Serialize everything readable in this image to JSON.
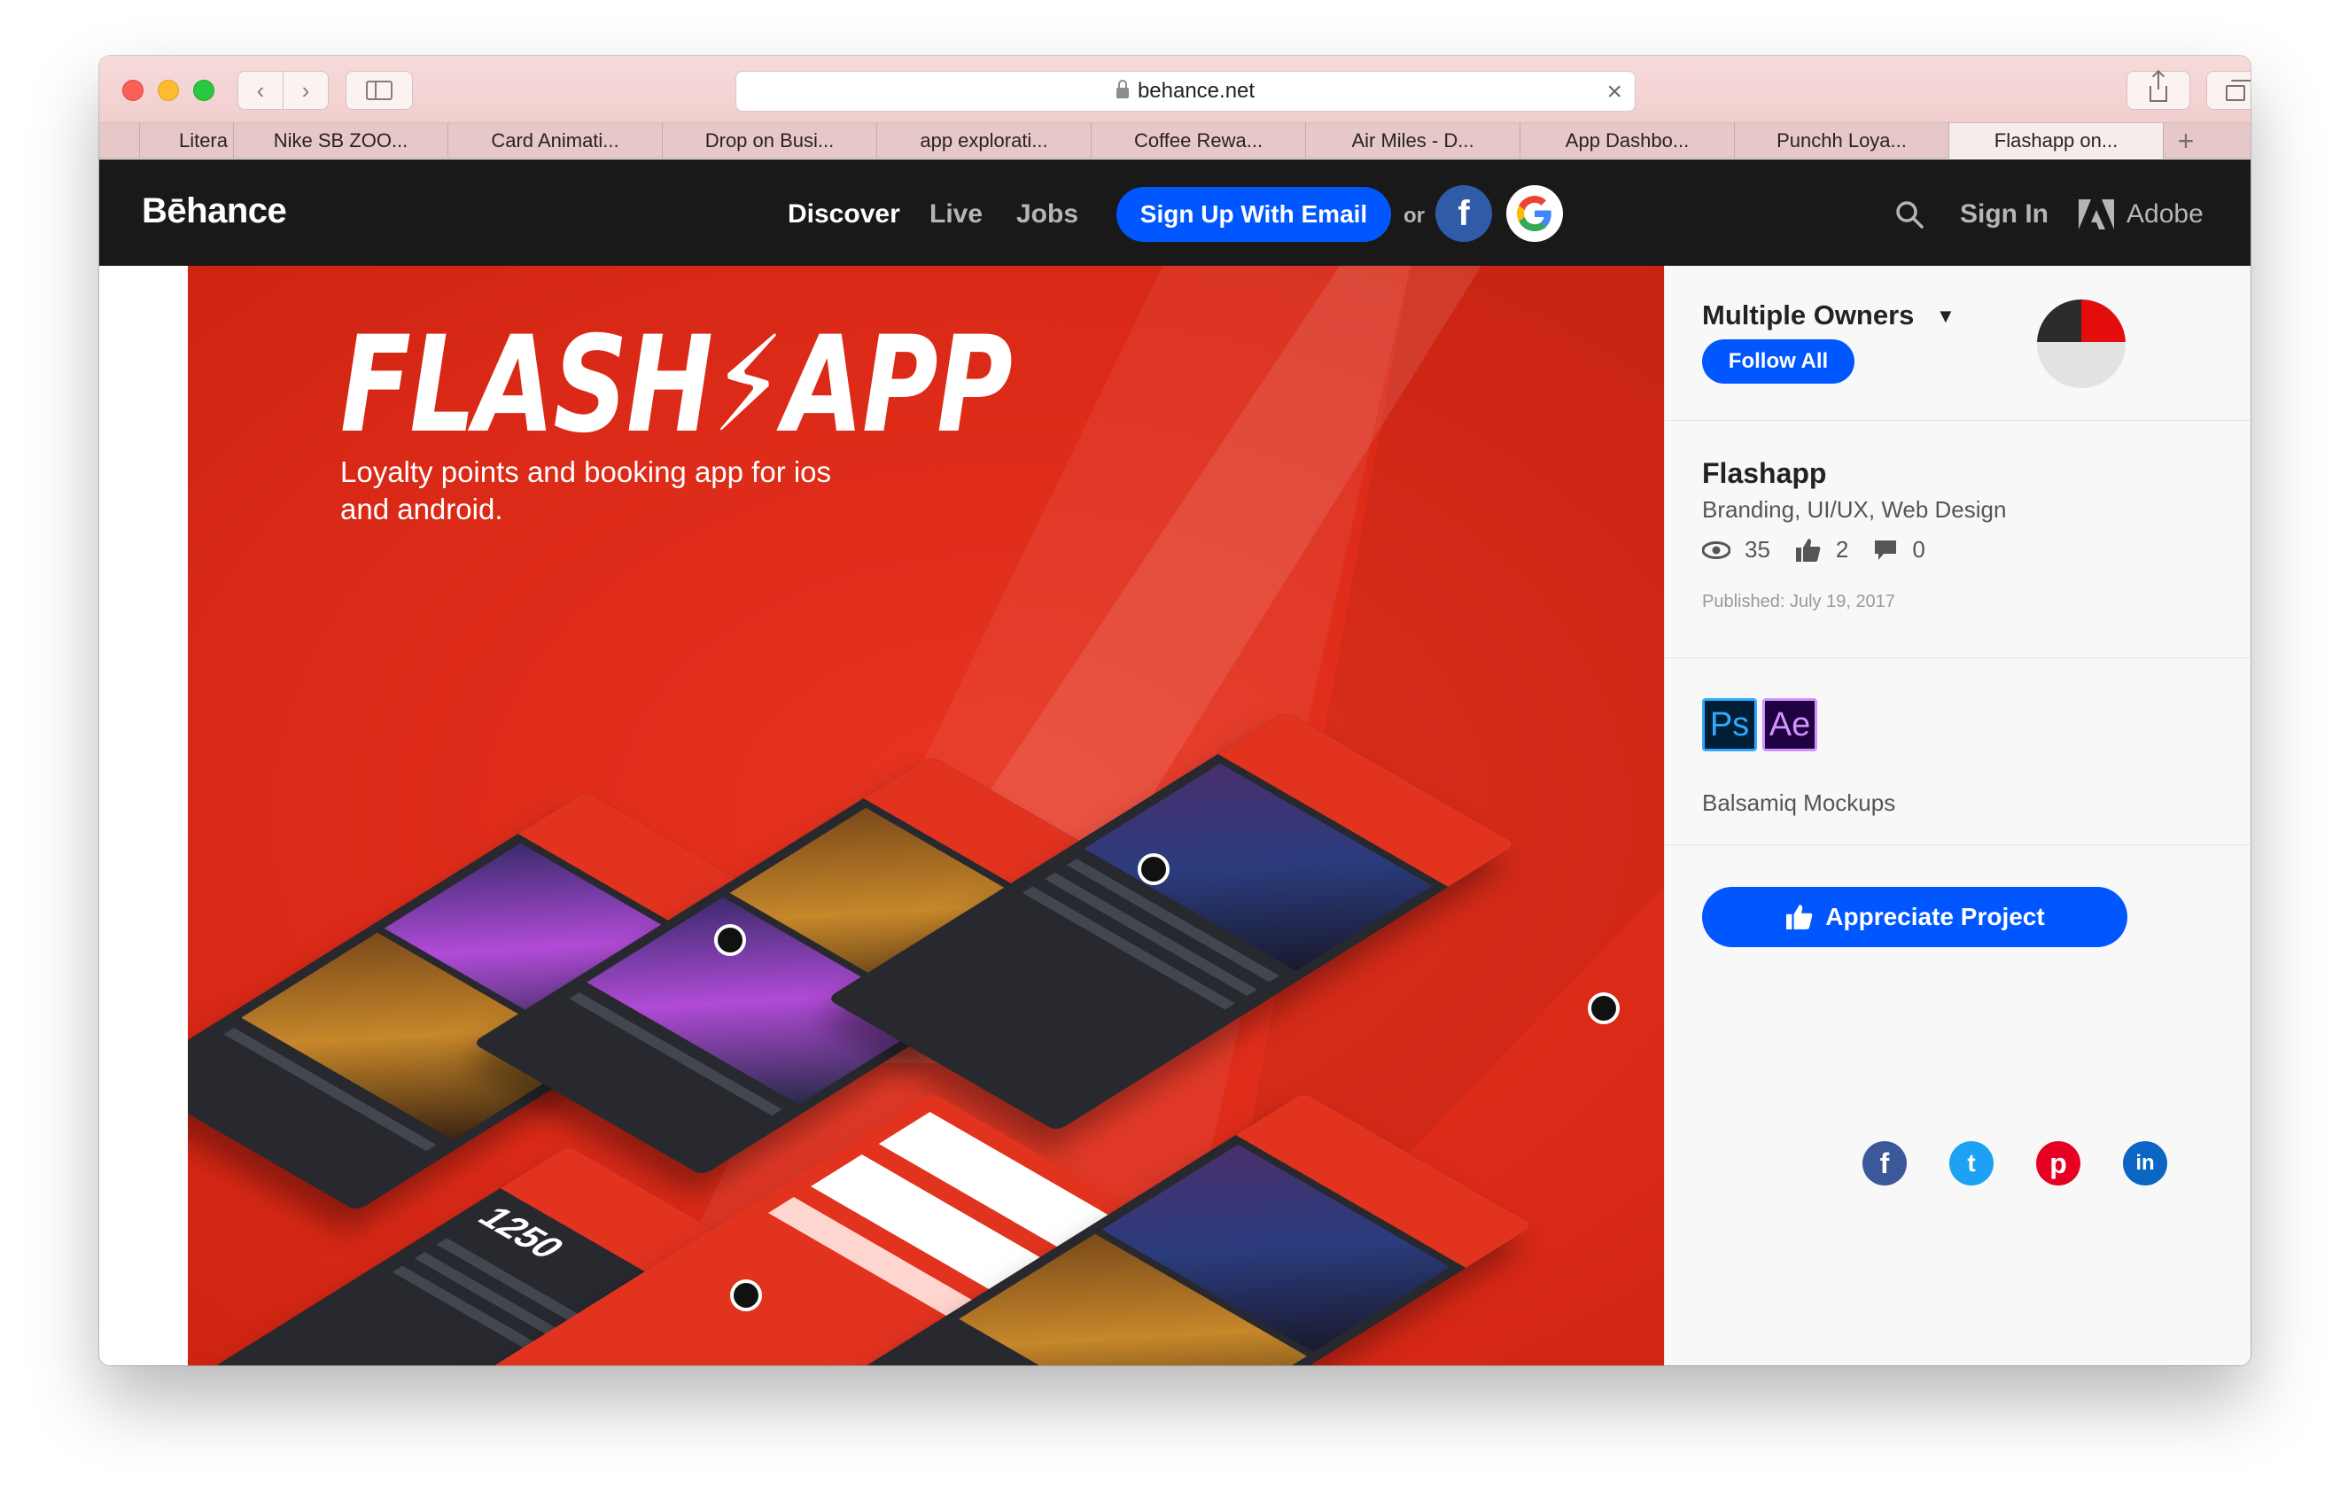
{
  "browser": {
    "url": "behance.net",
    "tabs": [
      {
        "label": "Litera"
      },
      {
        "label": "Nike SB ZOO..."
      },
      {
        "label": "Card Animati..."
      },
      {
        "label": "Drop on Busi..."
      },
      {
        "label": "app explorati..."
      },
      {
        "label": "Coffee Rewa..."
      },
      {
        "label": "Air Miles - D..."
      },
      {
        "label": "App Dashbo..."
      },
      {
        "label": "Punchh Loya..."
      },
      {
        "label": "Flashapp on..."
      }
    ],
    "new_tab_label": "+"
  },
  "header": {
    "logo": "Bēhance",
    "nav": {
      "discover": "Discover",
      "live": "Live",
      "jobs": "Jobs"
    },
    "signup_label": "Sign Up With Email",
    "or_label": "or",
    "facebook_glyph": "f",
    "signin_label": "Sign In",
    "adobe_label": "Adobe"
  },
  "hero": {
    "title": "FLASH⚡APP",
    "subtitle": "Loyalty points and booking app for ios and android.",
    "points_display": "1250"
  },
  "sidebar": {
    "owners_label": "Multiple Owners",
    "follow_label": "Follow All",
    "project_title": "Flashapp",
    "fields": "Branding, UI/UX, Web Design",
    "stats": {
      "views": "35",
      "appreciations": "2",
      "comments": "0"
    },
    "published": "Published: July 19, 2017",
    "tools": [
      {
        "abbr": "Ps"
      },
      {
        "abbr": "Ae"
      }
    ],
    "tools_text": "Balsamiq Mockups",
    "appreciate_label": "Appreciate Project"
  },
  "share": {
    "facebook": "f",
    "twitter": "t",
    "pinterest": "p",
    "linkedin": "in"
  },
  "colors": {
    "accent": "#0057ff",
    "header_bg": "#191919",
    "hero_red": "#dc2a18"
  }
}
